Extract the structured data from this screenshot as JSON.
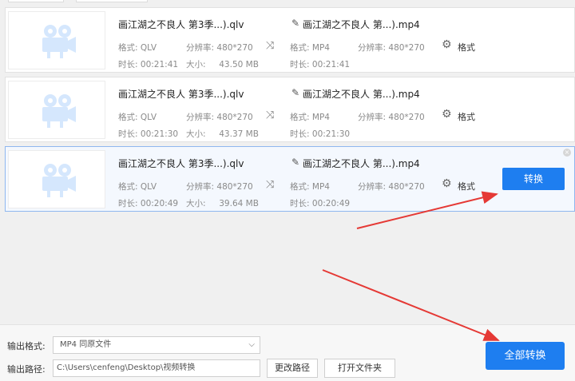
{
  "files": [
    {
      "source_name": "画江湖之不良人 第3季...).qlv",
      "target_name": "画江湖之不良人 第...).mp4",
      "src_format_label": "格式:",
      "src_format": "QLV",
      "src_res_label": "分辨率:",
      "src_res": "480*270",
      "src_duration_label": "时长:",
      "src_duration": "00:21:41",
      "src_size_label": "大小:",
      "src_size": "43.50 MB",
      "dst_format_label": "格式:",
      "dst_format": "MP4",
      "dst_res_label": "分辨率:",
      "dst_res": "480*270",
      "dst_duration_label": "时长:",
      "dst_duration": "00:21:41",
      "format_button": "格式"
    },
    {
      "source_name": "画江湖之不良人 第3季...).qlv",
      "target_name": "画江湖之不良人 第...).mp4",
      "src_format_label": "格式:",
      "src_format": "QLV",
      "src_res_label": "分辨率:",
      "src_res": "480*270",
      "src_duration_label": "时长:",
      "src_duration": "00:21:30",
      "src_size_label": "大小:",
      "src_size": "43.37 MB",
      "dst_format_label": "格式:",
      "dst_format": "MP4",
      "dst_res_label": "分辨率:",
      "dst_res": "480*270",
      "dst_duration_label": "时长:",
      "dst_duration": "00:21:30",
      "format_button": "格式"
    },
    {
      "source_name": "画江湖之不良人 第3季...).qlv",
      "target_name": "画江湖之不良人 第...).mp4",
      "src_format_label": "格式:",
      "src_format": "QLV",
      "src_res_label": "分辨率:",
      "src_res": "480*270",
      "src_duration_label": "时长:",
      "src_duration": "00:20:49",
      "src_size_label": "大小:",
      "src_size": "39.64 MB",
      "dst_format_label": "格式:",
      "dst_format": "MP4",
      "dst_res_label": "分辨率:",
      "dst_res": "480*270",
      "dst_duration_label": "时长:",
      "dst_duration": "00:20:49",
      "format_button": "格式",
      "convert_button": "转换"
    }
  ],
  "footer": {
    "output_format_label": "输出格式:",
    "output_format_value": "MP4  同原文件",
    "output_path_label": "输出路径:",
    "output_path_value": "C:\\Users\\cenfeng\\Desktop\\视频转换",
    "change_path_button": "更改路径",
    "open_folder_button": "打开文件夹",
    "convert_all_button": "全部转换"
  },
  "icons": {
    "video": "video-camera-icon",
    "shuffle": "shuffle-icon",
    "gear": "gear-icon",
    "pencil": "pencil-icon",
    "close": "close-icon",
    "chevron": "chevron-down-icon"
  },
  "colors": {
    "accent": "#1e7ef0",
    "selected_border": "#8fb7ef",
    "annotation_arrow": "#e53935"
  }
}
